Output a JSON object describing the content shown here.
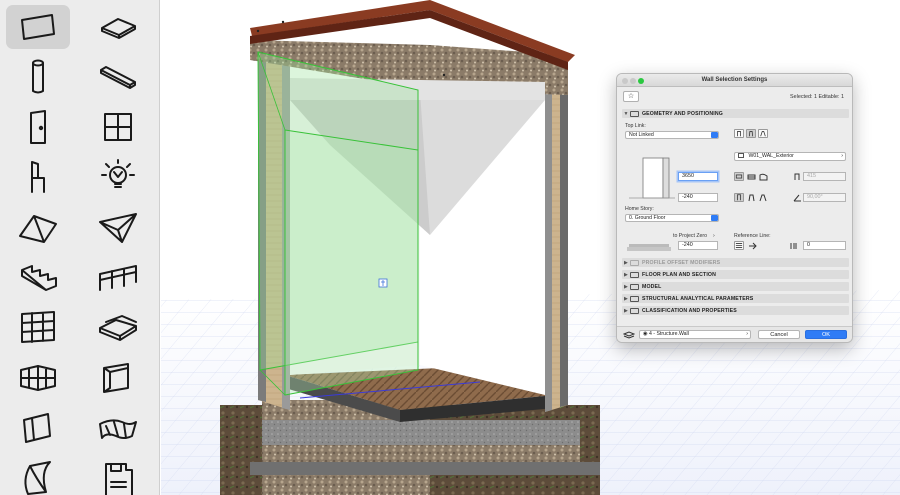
{
  "toolbox": {
    "tools": [
      {
        "name": "wall-tool-icon",
        "selected": true
      },
      {
        "name": "slab-tool-icon",
        "selected": false
      },
      {
        "name": "column-tool-icon",
        "selected": false
      },
      {
        "name": "beam-tool-icon",
        "selected": false
      },
      {
        "name": "door-tool-icon",
        "selected": false
      },
      {
        "name": "window-tool-icon",
        "selected": false
      },
      {
        "name": "object-chair-tool-icon",
        "selected": false
      },
      {
        "name": "lamp-tool-icon",
        "selected": false
      },
      {
        "name": "roof-tool-icon",
        "selected": false
      },
      {
        "name": "shell-tool-icon",
        "selected": false
      },
      {
        "name": "stair-tool-icon",
        "selected": false
      },
      {
        "name": "railing-tool-icon",
        "selected": false
      },
      {
        "name": "curtain-wall-tool-icon",
        "selected": false
      },
      {
        "name": "mesh-tool-icon",
        "selected": false
      },
      {
        "name": "zone-3d-tool-icon",
        "selected": false
      },
      {
        "name": "corner-window-tool-icon",
        "selected": false
      },
      {
        "name": "wall-end-tool-icon",
        "selected": false
      },
      {
        "name": "skylight-tool-icon",
        "selected": false
      },
      {
        "name": "morph-tool-icon",
        "selected": false
      },
      {
        "name": "floppy-object-tool-icon",
        "selected": false
      }
    ]
  },
  "dialog": {
    "title": "Wall Selection Settings",
    "selection_info": "Selected: 1 Editable: 1",
    "favorites_icon": "star-icon",
    "geometry": {
      "header": "GEOMETRY AND POSITIONING",
      "top_link_label": "Top Link:",
      "top_link_value": "Not Linked",
      "height_value": "3650",
      "offset_value": "-240",
      "home_story_label": "Home Story:",
      "home_story_value": "0. Ground Floor",
      "to_project_zero_label": "to Project Zero",
      "project_zero_value": "-240",
      "composite_value": "W01_WAL_Exterior",
      "thickness_value": "415",
      "angle_value": "90,00°",
      "reference_line_label": "Reference Line:",
      "reference_offset_value": "0"
    },
    "sections": [
      {
        "label": "PROFILE OFFSET MODIFIERS",
        "dim": true
      },
      {
        "label": "FLOOR PLAN AND SECTION",
        "dim": false
      },
      {
        "label": "MODEL",
        "dim": false
      },
      {
        "label": "STRUCTURAL ANALYTICAL PARAMETERS",
        "dim": false
      },
      {
        "label": "CLASSIFICATION AND PROPERTIES",
        "dim": false
      }
    ],
    "layer_value": "4 - Structure.Wall",
    "cancel_label": "Cancel",
    "ok_label": "OK"
  },
  "colors": {
    "accent": "#2f7cf6",
    "selection_green": "#5bd35b",
    "roof_red": "#8a3b22"
  }
}
